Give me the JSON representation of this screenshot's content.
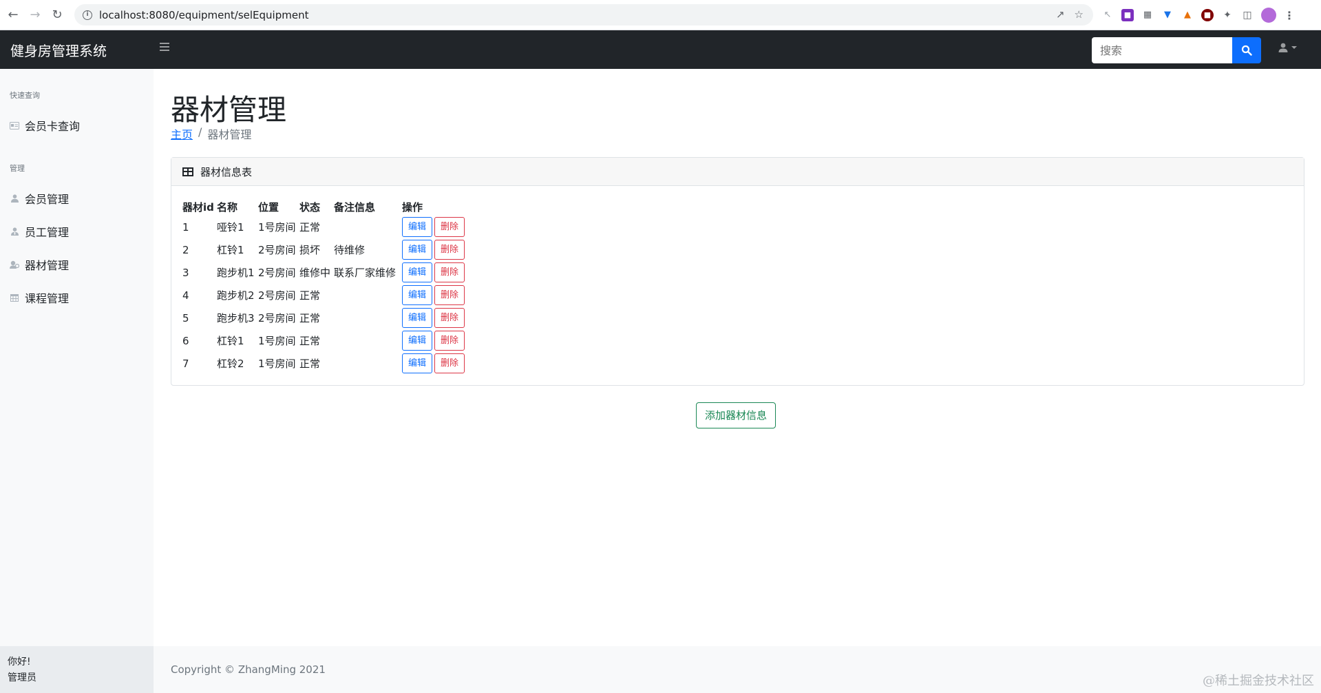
{
  "browser": {
    "url": "localhost:8080/equipment/selEquipment"
  },
  "header": {
    "brand": "健身房管理系统",
    "search_placeholder": "搜索"
  },
  "sidebar": {
    "section_quick": "快速查询",
    "quick_items": [
      {
        "label": "会员卡查询",
        "icon": "id-card-icon"
      }
    ],
    "section_manage": "管理",
    "manage_items": [
      {
        "label": "会员管理",
        "icon": "user-icon"
      },
      {
        "label": "员工管理",
        "icon": "user-tie-icon"
      },
      {
        "label": "器材管理",
        "icon": "equipment-icon"
      },
      {
        "label": "课程管理",
        "icon": "calendar-icon"
      }
    ],
    "footer_greeting": "你好!",
    "footer_role": "管理员"
  },
  "main": {
    "title": "器材管理",
    "breadcrumb_home": "主页",
    "breadcrumb_current": "器材管理",
    "card_title": "器材信息表",
    "columns": [
      "器材id",
      "名称",
      "位置",
      "状态",
      "备注信息",
      "操作"
    ],
    "rows": [
      {
        "id": "1",
        "name": "哑铃1",
        "location": "1号房间",
        "status": "正常",
        "note": ""
      },
      {
        "id": "2",
        "name": "杠铃1",
        "location": "2号房间",
        "status": "损坏",
        "note": "待维修"
      },
      {
        "id": "3",
        "name": "跑步机1",
        "location": "2号房间",
        "status": "维修中",
        "note": "联系厂家维修"
      },
      {
        "id": "4",
        "name": "跑步机2",
        "location": "2号房间",
        "status": "正常",
        "note": ""
      },
      {
        "id": "5",
        "name": "跑步机3",
        "location": "2号房间",
        "status": "正常",
        "note": ""
      },
      {
        "id": "6",
        "name": "杠铃1",
        "location": "1号房间",
        "status": "正常",
        "note": ""
      },
      {
        "id": "7",
        "name": "杠铃2",
        "location": "1号房间",
        "status": "正常",
        "note": ""
      }
    ],
    "edit_label": "编辑",
    "delete_label": "删除",
    "add_label": "添加器材信息"
  },
  "footer": {
    "copyright": "Copyright © ZhangMing 2021"
  },
  "watermark": "@稀土掘金技术社区",
  "colors": {
    "navbar": "#212529",
    "primary": "#0d6efd",
    "danger": "#dc3545",
    "success": "#198754",
    "sidebar": "#f8f9fa"
  }
}
